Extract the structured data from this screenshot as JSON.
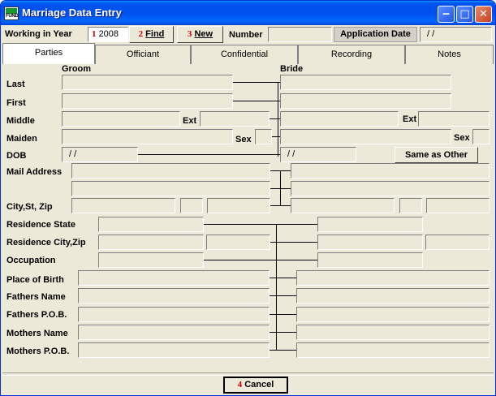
{
  "window": {
    "title": "Marriage Data Entry",
    "icon_text": "FUND"
  },
  "toolbar": {
    "working_in_year_label": "Working in Year",
    "num1": "1",
    "year_value": "2008",
    "num2": "2",
    "find_label": "Find",
    "num3": "3",
    "new_label": "New",
    "number_label": "Number",
    "number_value": "",
    "application_date_label": "Application Date",
    "application_date_value": "/ /"
  },
  "tabs": [
    "Parties",
    "Officiant",
    "Confidential",
    "Recording",
    "Notes"
  ],
  "headers": {
    "groom": "Groom",
    "bride": "Bride"
  },
  "labels": {
    "last": "Last",
    "first": "First",
    "middle": "Middle",
    "maiden": "Maiden",
    "dob": "DOB",
    "mail_address": "Mail Address",
    "city_st_zip": "City,St, Zip",
    "residence_state": "Residence State",
    "residence_city_zip": "Residence City,Zip",
    "occupation": "Occupation",
    "place_of_birth": "Place of Birth",
    "fathers_name": "Fathers Name",
    "fathers_pob": "Fathers P.O.B.",
    "mothers_name": "Mothers Name",
    "mothers_pob": "Mothers P.O.B.",
    "ext": "Ext",
    "sex": "Sex"
  },
  "groom": {
    "dob": "/ /"
  },
  "bride": {
    "dob": "/ /"
  },
  "buttons": {
    "same_as_other": "Same as Other",
    "num4": "4",
    "cancel": "Cancel"
  }
}
